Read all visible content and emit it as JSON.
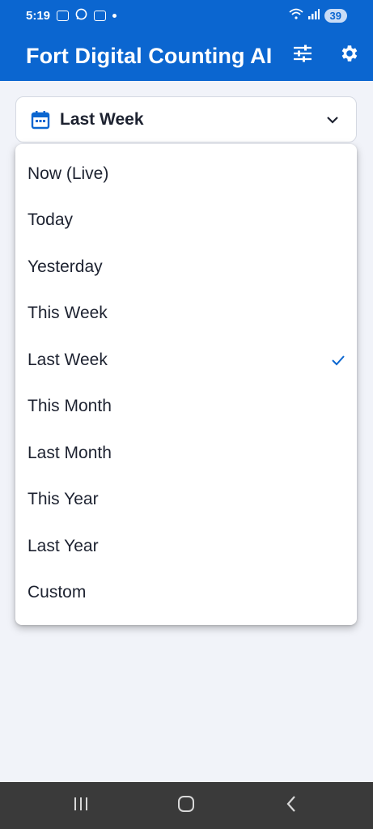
{
  "status": {
    "time": "5:19",
    "battery": "39"
  },
  "app": {
    "title": "Fort Digital Counting AI"
  },
  "select": {
    "value": "Last Week"
  },
  "options": [
    {
      "label": "Now (Live)"
    },
    {
      "label": "Today"
    },
    {
      "label": "Yesterday"
    },
    {
      "label": "This Week"
    },
    {
      "label": "Last Week",
      "selected": true
    },
    {
      "label": "This Month"
    },
    {
      "label": "Last Month"
    },
    {
      "label": "This Year"
    },
    {
      "label": "Last Year"
    },
    {
      "label": "Custom"
    }
  ],
  "colors": {
    "primary": "#0b66d0",
    "text": "#1d2230",
    "background": "#f1f3f9",
    "navbar": "#3a3a3a"
  },
  "icons": {
    "status": [
      "screenshot-icon",
      "whatsapp-icon",
      "gallery-icon",
      "dot-icon",
      "wifi-icon",
      "signal-icon"
    ],
    "appbar": [
      "sliders-icon",
      "gear-icon"
    ],
    "select": [
      "calendar-icon",
      "chevron-down-icon"
    ],
    "selected": "checkmark-icon",
    "nav": [
      "recents-icon",
      "home-icon",
      "back-icon"
    ]
  }
}
